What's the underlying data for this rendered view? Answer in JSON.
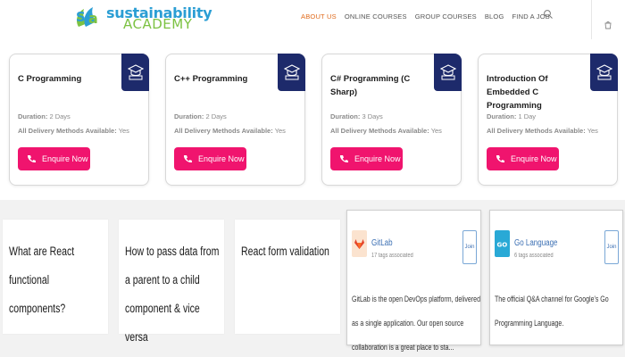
{
  "header": {
    "logo_line1": "sustainability",
    "logo_line2": "ACADEMY",
    "nav": [
      "ABOUT US",
      "ONLINE COURSES",
      "GROUP COURSES",
      "BLOG",
      "FIND A JOB"
    ],
    "active_nav_index": 0,
    "accent_color": "#e06a1b"
  },
  "courses": [
    {
      "title": "C Programming",
      "duration_label": "Duration:",
      "duration": "2 Days",
      "delivery_label": "All Delivery Methods Available:",
      "delivery": "Yes",
      "cta": "Enquire Now"
    },
    {
      "title": "C++ Programming",
      "duration_label": "Duration:",
      "duration": "2 Days",
      "delivery_label": "All Delivery Methods Available:",
      "delivery": "Yes",
      "cta": "Enquire Now"
    },
    {
      "title": "C# Programming (C Sharp)",
      "duration_label": "Duration:",
      "duration": "3 Days",
      "delivery_label": "All Delivery Methods Available:",
      "delivery": "Yes",
      "cta": "Enquire Now"
    },
    {
      "title": "Introduction Of Embedded C Programming",
      "duration_label": "Duration:",
      "duration": "1 Day",
      "delivery_label": "All Delivery Methods Available:",
      "delivery": "Yes",
      "cta": "Enquire Now"
    }
  ],
  "questions": [
    {
      "text": "What are React functional components?"
    },
    {
      "text": "How to pass data from a parent to a child component & vice versa"
    },
    {
      "text": "React form validation"
    }
  ],
  "tags": [
    {
      "name": "GitLab",
      "count": "17 tags associated",
      "join": "Join",
      "description": "GitLab is the open DevOps platform, delivered as a single application. Our open source collaboration is a great place to sta...",
      "icon": "gitlab-icon",
      "color": "#f4a259"
    },
    {
      "name": "Go Language",
      "count": "6 tags associated",
      "join": "Join",
      "description": "The official Q&A channel for Google's Go Programming Language.",
      "icon": "go-icon",
      "color": "#29a9d6"
    }
  ],
  "colors": {
    "badge": "#1d2a6b",
    "cta": "#f0146e",
    "logo_blue": "#2b9ed4",
    "logo_green": "#7cc242"
  }
}
